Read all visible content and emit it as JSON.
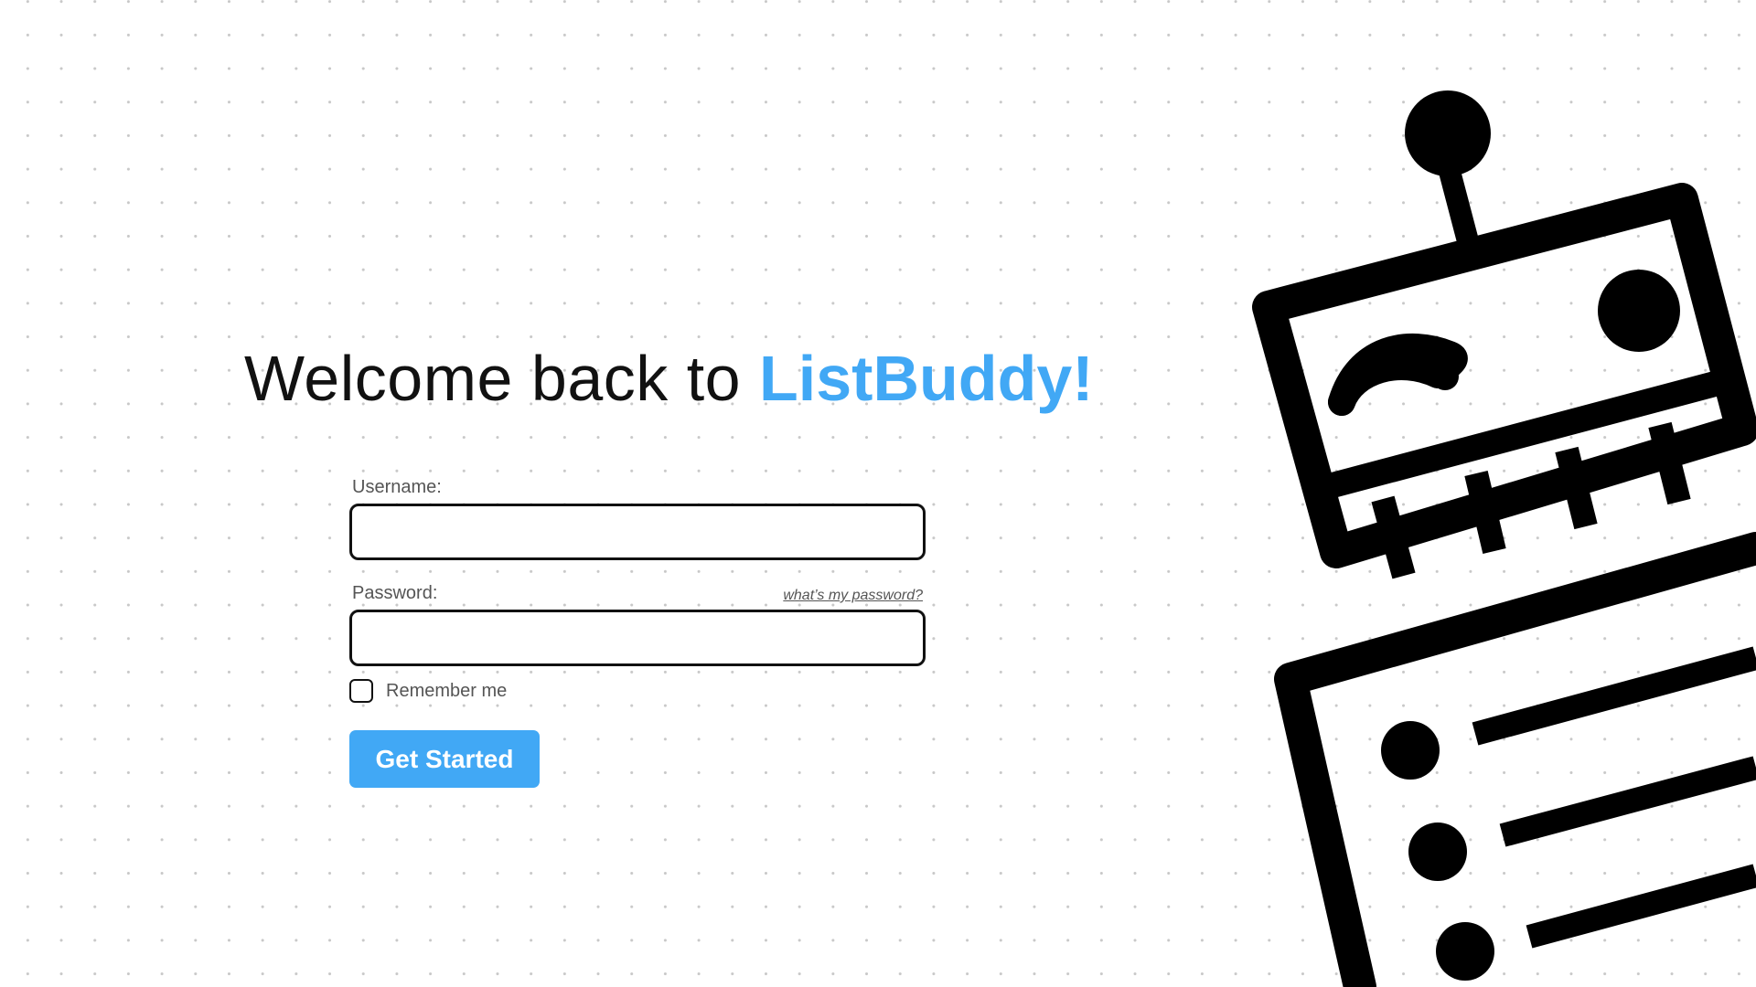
{
  "colors": {
    "accent": "#41a8f5",
    "text": "#111111",
    "muted": "#555555"
  },
  "header": {
    "welcome_text": "Welcome back to ",
    "brand_name": "ListBuddy!"
  },
  "form": {
    "username_label": "Username:",
    "username_value": "",
    "password_label": "Password:",
    "password_value": "",
    "forgot_link": "what’s my password?",
    "remember_label": "Remember me",
    "remember_checked": false,
    "submit_label": "Get Started"
  },
  "illustration": {
    "icon": "robot-mascot-icon"
  }
}
